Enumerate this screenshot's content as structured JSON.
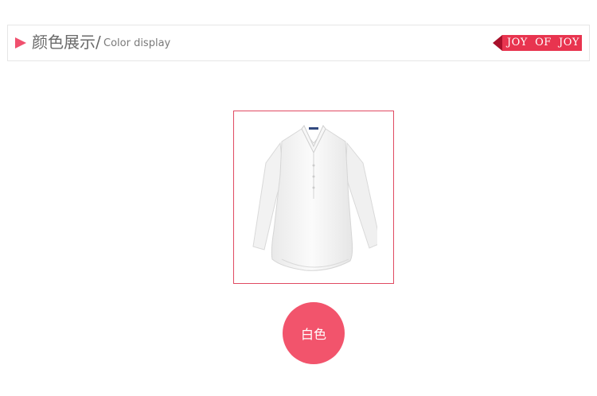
{
  "header": {
    "title_cn": "颜色展示/",
    "title_en": "Color display",
    "brand": "JOY  OF  JOY"
  },
  "product": {
    "image_icon": "white-blouse-image"
  },
  "colors": [
    {
      "label": "白色",
      "swatch": "#f2546c"
    }
  ],
  "theme": {
    "accent": "#f0506e",
    "frame_border": "#e04a62"
  }
}
